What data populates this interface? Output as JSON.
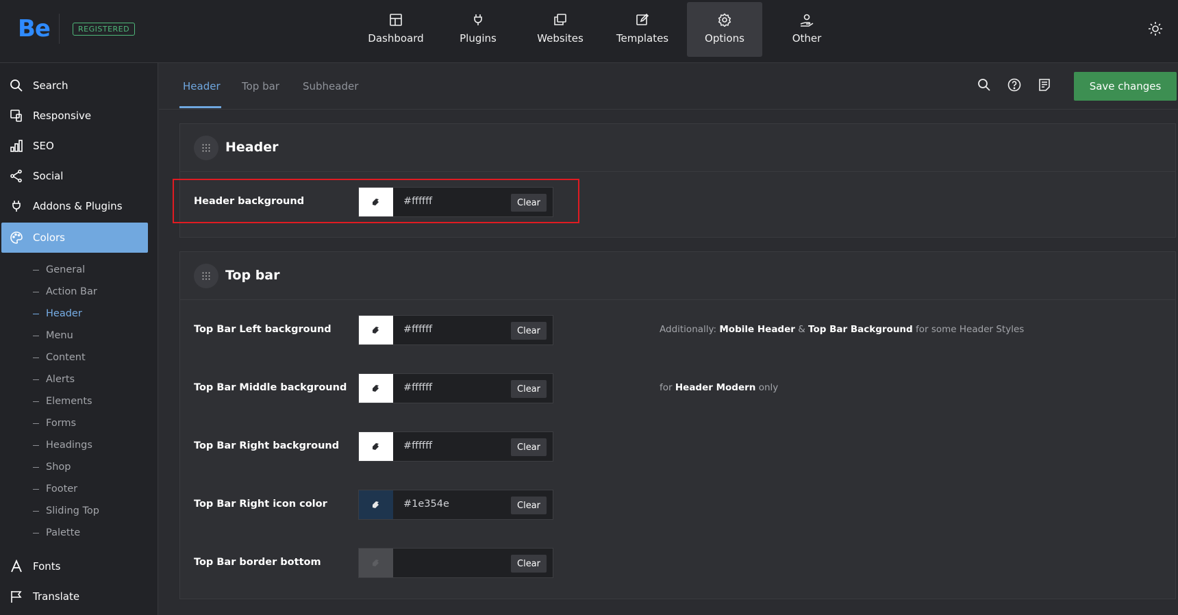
{
  "brand": {
    "logo": "Be",
    "badge": "REGISTERED"
  },
  "topnav": [
    {
      "label": "Dashboard",
      "icon": "dashboard-icon"
    },
    {
      "label": "Plugins",
      "icon": "plug-icon"
    },
    {
      "label": "Websites",
      "icon": "websites-icon"
    },
    {
      "label": "Templates",
      "icon": "templates-icon"
    },
    {
      "label": "Options",
      "icon": "gear-icon",
      "active": true
    },
    {
      "label": "Other",
      "icon": "user-hand-icon"
    }
  ],
  "sidebar": {
    "items": [
      {
        "label": "Search",
        "icon": "search-icon"
      },
      {
        "label": "Responsive",
        "icon": "responsive-icon"
      },
      {
        "label": "SEO",
        "icon": "bar-chart-icon"
      },
      {
        "label": "Social",
        "icon": "share-icon"
      },
      {
        "label": "Addons & Plugins",
        "icon": "plug-icon"
      },
      {
        "label": "Colors",
        "icon": "palette-icon",
        "active": true
      }
    ],
    "subitems": [
      "General",
      "Action Bar",
      "Header",
      "Menu",
      "Content",
      "Alerts",
      "Elements",
      "Forms",
      "Headings",
      "Shop",
      "Footer",
      "Sliding Top",
      "Palette"
    ],
    "active_sub": "Header",
    "bottom_items": [
      {
        "label": "Fonts",
        "icon": "font-icon"
      },
      {
        "label": "Translate",
        "icon": "flag-icon"
      }
    ]
  },
  "tabs": [
    "Header",
    "Top bar",
    "Subheader"
  ],
  "active_tab": "Header",
  "save_label": "Save changes",
  "panels": {
    "header": {
      "title": "Header",
      "rows": [
        {
          "label": "Header background",
          "value": "#ffffff",
          "swatch": "#ffffff"
        }
      ]
    },
    "topbar": {
      "title": "Top bar",
      "rows": [
        {
          "label": "Top Bar Left background",
          "value": "#ffffff",
          "swatch": "#ffffff"
        },
        {
          "label": "Top Bar Middle background",
          "value": "#ffffff",
          "swatch": "#ffffff"
        },
        {
          "label": "Top Bar Right background",
          "value": "#ffffff",
          "swatch": "#ffffff"
        },
        {
          "label": "Top Bar Right icon color",
          "value": "#1e354e",
          "swatch": "#1e354e"
        },
        {
          "label": "Top Bar border bottom",
          "value": "",
          "swatch": ""
        }
      ]
    }
  },
  "clear_label": "Clear",
  "hints": {
    "left_prefix": "Additionally: ",
    "left_b1": "Mobile Header",
    "left_amp": " & ",
    "left_b2": "Top Bar Background",
    "left_suffix": " for some Header Styles",
    "middle_prefix": "for ",
    "middle_b": "Header Modern",
    "middle_suffix": " only"
  },
  "colors": {
    "accent": "#6fa7df",
    "save": "#3d8f52",
    "highlight": "#e11b22"
  }
}
